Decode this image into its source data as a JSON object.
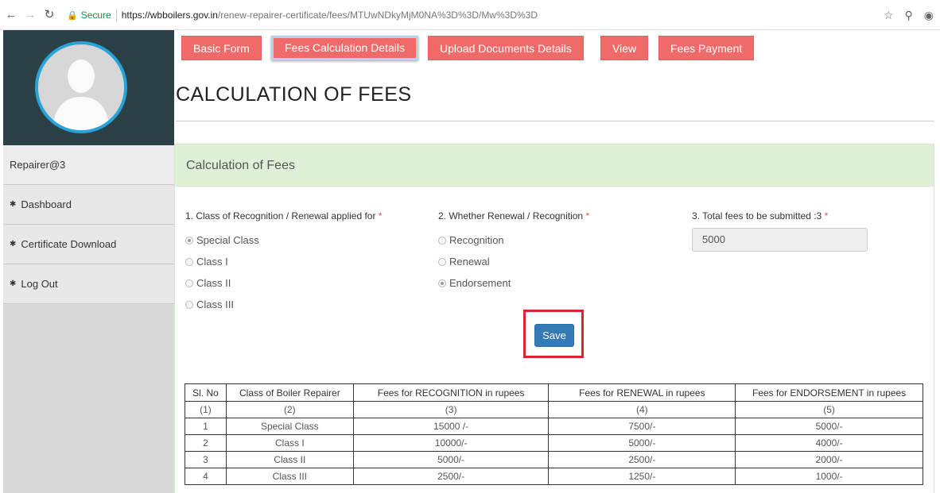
{
  "browser": {
    "secure_label": "Secure",
    "url_host": "https://wbboilers.gov.in",
    "url_path": "/renew-repairer-certificate/fees/MTUwNDkyMjM0NA%3D%3D/Mw%3D%3D"
  },
  "sidebar": {
    "username": "Repairer@3",
    "items": [
      {
        "label": "Dashboard",
        "icon": "tachometer-icon"
      },
      {
        "label": "Certificate Download",
        "icon": "tachometer-icon"
      },
      {
        "label": "Log Out",
        "icon": "tachometer-icon"
      }
    ]
  },
  "tabs": [
    {
      "label": "Basic Form"
    },
    {
      "label": "Fees Calculation Details",
      "active": true
    },
    {
      "label": "Upload Documents Details"
    },
    {
      "label": "View"
    },
    {
      "label": "Fees Payment"
    }
  ],
  "page_title": "CALCULATION OF FEES",
  "panel": {
    "heading": "Calculation of Fees",
    "field1_label": "1. Class of Recognition / Renewal applied for",
    "field1_options": [
      "Special Class",
      "Class I",
      "Class II",
      "Class III"
    ],
    "field1_selected": "Special Class",
    "field2_label": "2. Whether Renewal / Recognition",
    "field2_options": [
      "Recognition",
      "Renewal",
      "Endorsement"
    ],
    "field2_selected": "Endorsement",
    "field3_label": "3. Total fees to be submitted :3",
    "field3_value": "5000",
    "required_mark": "*",
    "save_label": "Save"
  },
  "fees_table": {
    "headers": [
      "Sl. No",
      "Class of Boiler Repairer",
      "Fees for RECOGNITION in rupees",
      "Fees for RENEWAL in rupees",
      "Fees for ENDORSEMENT in rupees"
    ],
    "rows": [
      [
        "(1)",
        "(2)",
        "(3)",
        "(4)",
        "(5)"
      ],
      [
        "1",
        "Special Class",
        "15000 /-",
        "7500/-",
        "5000/-"
      ],
      [
        "2",
        "Class I",
        "10000/-",
        "5000/-",
        "4000/-"
      ],
      [
        "3",
        "Class II",
        "5000/-",
        "2500/-",
        "2000/-"
      ],
      [
        "4",
        "Class III",
        "2500/-",
        "1250/-",
        "1000/-"
      ]
    ]
  },
  "colors": {
    "tab_bg": "#f06a6a",
    "panel_head_bg": "#dff0d8",
    "save_btn": "#337ab7",
    "highlight_box": "#d7282f",
    "sidebar_top": "#2b3f47"
  }
}
